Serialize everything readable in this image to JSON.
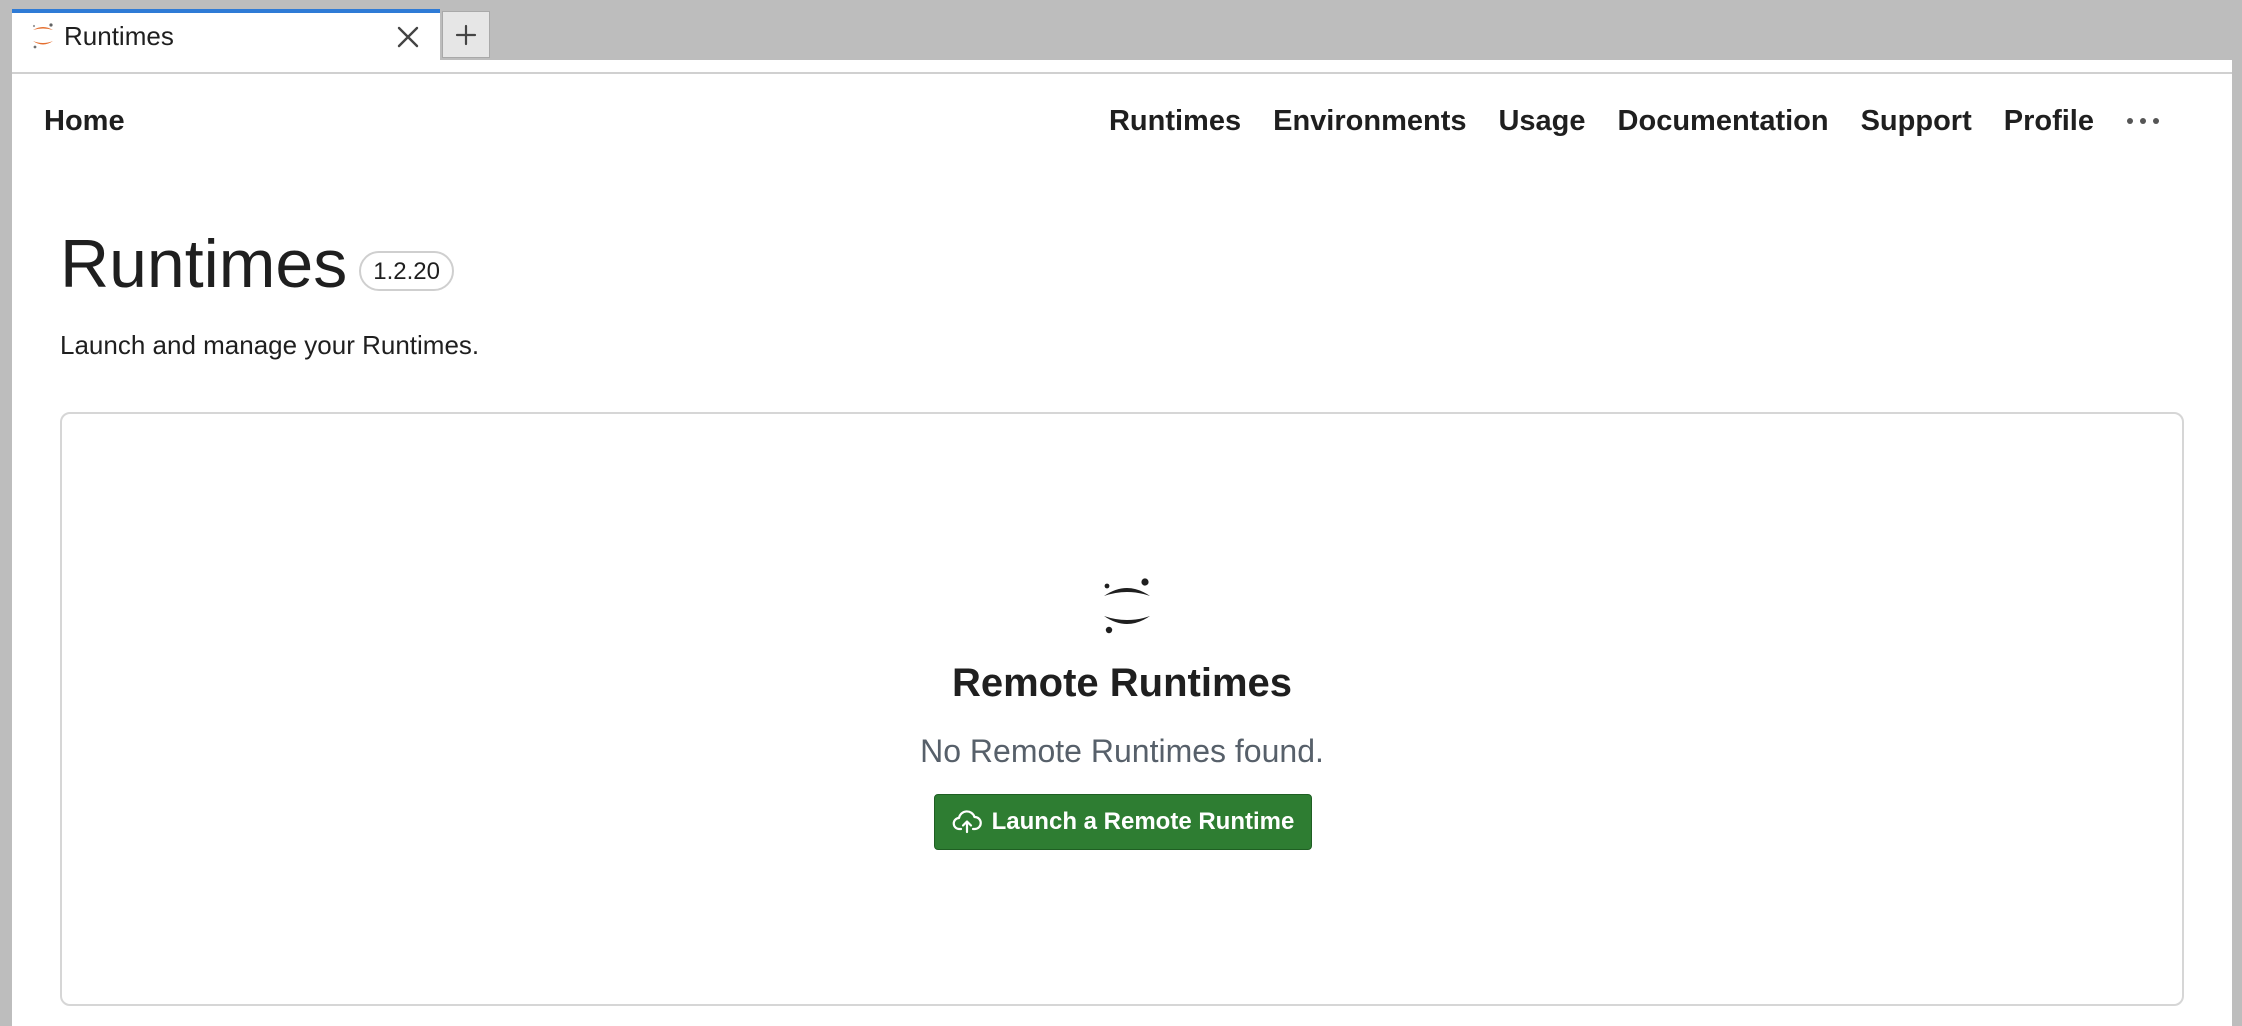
{
  "tabbar": {
    "active_tab": {
      "title": "Runtimes",
      "icon": "jupyter-logo-icon",
      "accent": "#2f7bd6"
    },
    "close_icon": "close-icon",
    "new_tab_icon": "plus-icon"
  },
  "nav": {
    "home": "Home",
    "links": [
      "Runtimes",
      "Environments",
      "Usage",
      "Documentation",
      "Support",
      "Profile"
    ],
    "more_icon": "more-horizontal-icon"
  },
  "page": {
    "title": "Runtimes",
    "version": "1.2.20",
    "subtitle": "Launch and manage your Runtimes."
  },
  "empty_state": {
    "icon": "jupyter-logo-icon",
    "title": "Remote Runtimes",
    "description": "No Remote Runtimes found.",
    "button_label": "Launch a Remote Runtime",
    "button_icon": "cloud-upload-icon",
    "button_color": "#2e7d32"
  }
}
